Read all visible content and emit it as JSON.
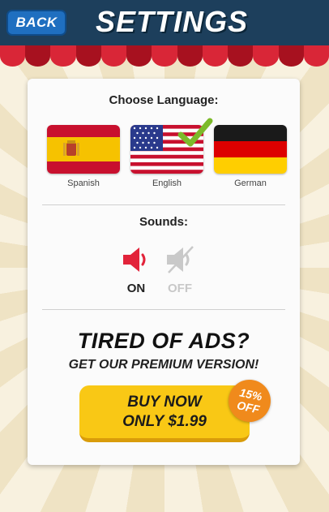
{
  "header": {
    "back_label": "BACK",
    "title": "SETTINGS",
    "bg_color": "#1d3f5c",
    "back_color": "#1f6fc0"
  },
  "language": {
    "heading": "Choose Language:",
    "selected": "English",
    "options": [
      {
        "label": "Spanish",
        "flag": "spain-flag-icon"
      },
      {
        "label": "English",
        "flag": "usa-flag-icon"
      },
      {
        "label": "German",
        "flag": "germany-flag-icon"
      }
    ]
  },
  "sounds": {
    "heading": "Sounds:",
    "on_label": "ON",
    "off_label": "OFF",
    "selected": "ON",
    "on_icon": "speaker-on-icon",
    "off_icon": "speaker-muted-icon",
    "active_color": "#e2233a"
  },
  "promo": {
    "title": "TIRED OF ADS?",
    "subtitle": "GET OUR PREMIUM VERSION!",
    "buy_line1": "BUY NOW",
    "buy_line2": "ONLY $1.99",
    "badge_line1": "15%",
    "badge_line2": "OFF",
    "button_color": "#f9c815",
    "badge_color": "#f08a1c"
  }
}
